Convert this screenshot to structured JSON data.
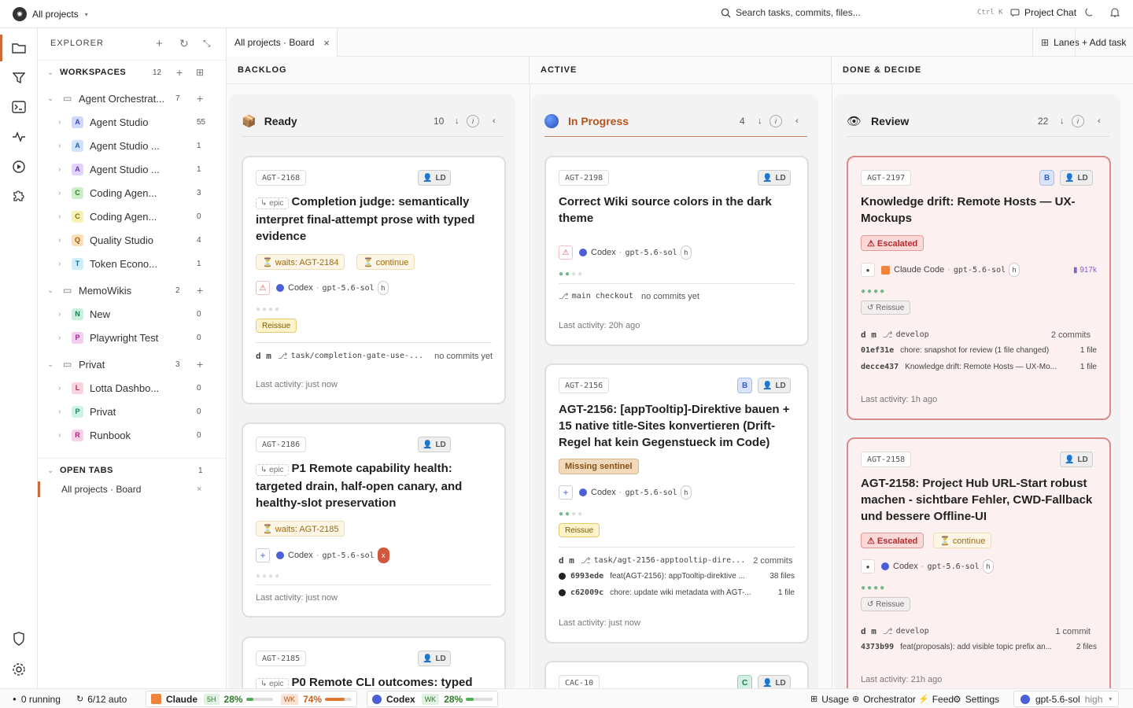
{
  "topbar": {
    "project": "All projects",
    "search_placeholder": "Search tasks, commits, files...",
    "shortcut": "Ctrl K",
    "chat": "Project Chat"
  },
  "explorer": {
    "title": "EXPLORER",
    "workspaces_label": "WORKSPACES",
    "workspaces_count": "12",
    "groups": [
      {
        "name": "Agent Orchestrat...",
        "count": "7",
        "items": [
          {
            "letter": "A",
            "color": "#cfd8ff",
            "fg": "#3a4fb8",
            "name": "Agent Studio",
            "count": "55"
          },
          {
            "letter": "A",
            "color": "#cfe3ff",
            "fg": "#2f62a8",
            "name": "Agent Studio ...",
            "count": "1"
          },
          {
            "letter": "A",
            "color": "#e2d2ff",
            "fg": "#6a3bb0",
            "name": "Agent Studio ...",
            "count": "1"
          },
          {
            "letter": "C",
            "color": "#cdeec9",
            "fg": "#2e7a2a",
            "name": "Coding Agen...",
            "count": "3"
          },
          {
            "letter": "C",
            "color": "#f8f1b4",
            "fg": "#7d6b12",
            "name": "Coding Agen...",
            "count": "0"
          },
          {
            "letter": "Q",
            "color": "#fde0b8",
            "fg": "#9a5a12",
            "name": "Quality Studio",
            "count": "4"
          },
          {
            "letter": "T",
            "color": "#cfeefc",
            "fg": "#1d6f93",
            "name": "Token Econo...",
            "count": "1"
          }
        ]
      },
      {
        "name": "MemoWikis",
        "count": "2",
        "items": [
          {
            "letter": "N",
            "color": "#c9f0dc",
            "fg": "#1f7a4a",
            "name": "New",
            "count": "0"
          },
          {
            "letter": "P",
            "color": "#f6cdf0",
            "fg": "#8e2f86",
            "name": "Playwright Test",
            "count": "0"
          }
        ]
      },
      {
        "name": "Privat",
        "count": "3",
        "items": [
          {
            "letter": "L",
            "color": "#fbd3dd",
            "fg": "#a2304f",
            "name": "Lotta Dashbo...",
            "count": "0"
          },
          {
            "letter": "P",
            "color": "#cdf3e6",
            "fg": "#207a5f",
            "name": "Privat",
            "count": "0"
          },
          {
            "letter": "R",
            "color": "#f7cfe8",
            "fg": "#9b2c72",
            "name": "Runbook",
            "count": "0"
          }
        ]
      }
    ],
    "open_tabs_label": "OPEN TABS",
    "open_tabs_count": "1",
    "open_tab": "All projects · Board"
  },
  "tab": {
    "label": "All projects · Board",
    "close": "×"
  },
  "toolbar": {
    "lanes": "Lanes",
    "add_task": "+ Add task"
  },
  "columns": [
    {
      "label": "BACKLOG"
    },
    {
      "label": "ACTIVE"
    },
    {
      "label": "DONE & DECIDE"
    }
  ],
  "lanes": [
    {
      "name": "Ready",
      "count": "10",
      "color": "#222"
    },
    {
      "name": "In Progress",
      "count": "4",
      "color": "#b5541e"
    },
    {
      "name": "Review",
      "count": "22",
      "color": "#222"
    }
  ],
  "cards": {
    "c2168": {
      "id": "AGT-2168",
      "epic": "↳ epic",
      "title": "Completion judge: semantically interpret final-attempt prose with typed evidence",
      "wait": "⏳ waits: AGT-2184",
      "cont": "⏳ continue",
      "agent": "Codex",
      "model": "gpt-5.6-sol",
      "mode": "h",
      "reissue": "Reissue",
      "user": "d m",
      "branch": "task/completion-gate-use-...",
      "commits": "no commits yet",
      "activity": "Last activity: just now",
      "avatar": "LD"
    },
    "c2186": {
      "id": "AGT-2186",
      "epic": "↳ epic",
      "title": "P1 Remote capability health: targeted drain, half-open canary, and healthy-slot preservation",
      "wait": "⏳ waits: AGT-2185",
      "agent": "Codex",
      "model": "gpt-5.6-sol",
      "mode": "x",
      "activity": "Last activity: just now",
      "avatar": "LD"
    },
    "c2185": {
      "id": "AGT-2185",
      "epic": "↳ epic",
      "title": "P0 Remote CLI outcomes: typed",
      "avatar": "LD"
    },
    "c2198": {
      "id": "AGT-2198",
      "title": "Correct Wiki source colors in the dark theme",
      "agent": "Codex",
      "model": "gpt-5.6-sol",
      "mode": "h",
      "branch": "main checkout",
      "commits": "no commits yet",
      "activity": "Last activity: 20h ago",
      "avatar": "LD"
    },
    "c2156": {
      "id": "AGT-2156",
      "title": "AGT-2156: [appTooltip]-Direktive bauen + 15 native title-Sites konvertieren (Drift-Regel hat kein Gegenstueck im Code)",
      "missing": "Missing sentinel",
      "agent": "Codex",
      "model": "gpt-5.6-sol",
      "mode": "h",
      "reissue": "Reissue",
      "user": "d m",
      "branch": "task/agt-2156-apptooltip-dire...",
      "commits": "2 commits",
      "c1hash": "6993ede",
      "c1msg": "feat(AGT-2156): appTooltip-direktive ...",
      "c1files": "38 files",
      "c2hash": "c62009c",
      "c2msg": "chore: update wiki metadata with AGT-...",
      "c2files": "1 file",
      "activity": "Last activity: just now",
      "avatarB": "B",
      "avatar": "LD"
    },
    "cac10": {
      "id": "CAC-10",
      "avatarC": "C",
      "avatar": "LD"
    },
    "c2197": {
      "id": "AGT-2197",
      "title": "Knowledge drift: Remote Hosts — UX-Mockups",
      "escalated": "⚠ Escalated",
      "agent": "Claude Code",
      "model": "gpt-5.6-sol",
      "mode": "h",
      "tokens": "917k",
      "reissue": "↺ Reissue",
      "user": "d m",
      "branch": "develop",
      "commits": "2 commits",
      "c1hash": "01ef31e",
      "c1msg": "chore: snapshot for review (1 file changed)",
      "c1files": "1 file",
      "c2hash": "decce437",
      "c2msg": "Knowledge drift: Remote Hosts — UX-Mo...",
      "c2files": "1 file",
      "activity": "Last activity: 1h ago",
      "avatarB": "B",
      "avatar": "LD"
    },
    "c2158": {
      "id": "AGT-2158",
      "title": "AGT-2158: Project Hub URL-Start robust machen - sichtbare Fehler, CWD-Fallback und bessere Offline-UI",
      "escalated": "⚠ Escalated",
      "cont": "⏳ continue",
      "agent": "Codex",
      "model": "gpt-5.6-sol",
      "mode": "h",
      "reissue": "↺ Reissue",
      "user": "d m",
      "branch": "develop",
      "commits": "1 commit",
      "c1hash": "4373b99",
      "c1msg": "feat(proposals): add visible topic prefix an...",
      "c1files": "2 files",
      "activity": "Last activity: 21h ago",
      "avatar": "LD"
    }
  },
  "status": {
    "running": "0 running",
    "auto": "6/12 auto",
    "claude": "Claude",
    "claude_5h": "5H",
    "claude_5h_pct": "28%",
    "claude_5h_val": 0.28,
    "claude_wk": "WK",
    "claude_wk_pct": "74%",
    "claude_wk_val": 0.74,
    "codex": "Codex",
    "codex_wk": "WK",
    "codex_wk_pct": "28%",
    "codex_wk_val": 0.28,
    "usage": "Usage",
    "orchestrator": "Orchestrator",
    "feed": "Feed",
    "settings": "Settings",
    "model": "gpt-5.6-sol",
    "effort": "high"
  }
}
